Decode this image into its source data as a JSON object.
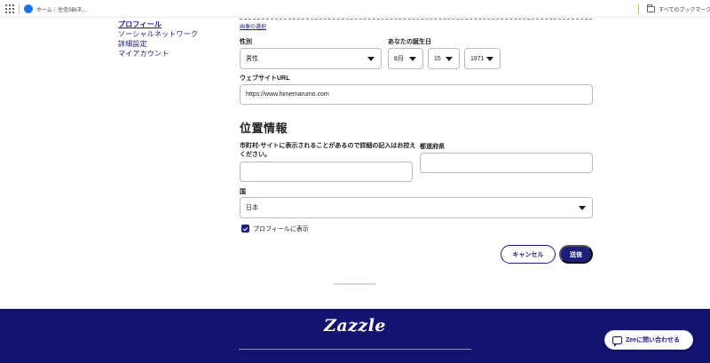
{
  "bookmarks": {
    "first_item": "ホーム｜住信SBIネ...",
    "all_bookmarks": "すべてのブックマーク"
  },
  "sidenav": {
    "items": [
      {
        "label": "プロフィール",
        "active": true
      },
      {
        "label": "ソーシャルネットワーク"
      },
      {
        "label": "詳細設定"
      },
      {
        "label": "マイアカウント"
      }
    ]
  },
  "profile": {
    "image_select": "画像の選択",
    "gender_label": "性別",
    "gender_value": "男性",
    "birthday_label": "あなたの誕生日",
    "birth_month": "8月",
    "birth_day": "15",
    "birth_year": "1971",
    "website_label": "ウェブサイトURL",
    "website_value": "https://www.himemarumo.com"
  },
  "location": {
    "title": "位置情報",
    "city_label": "市町村-サイトに表示されることがあるので詳細の記入はお控えください。",
    "city_value": "",
    "prefecture_label": "都道府県",
    "prefecture_value": "",
    "country_label": "国",
    "country_value": "日本",
    "show_on_profile": "プロフィールに表示",
    "show_on_profile_checked": true
  },
  "actions": {
    "cancel": "キャンセル",
    "submit": "送信"
  },
  "footer": {
    "logo": "Zazzle",
    "chat": "Zeeに問い合わせる"
  },
  "colors": {
    "brand_navy": "#1d1d7e",
    "footer_bg": "#141470"
  }
}
